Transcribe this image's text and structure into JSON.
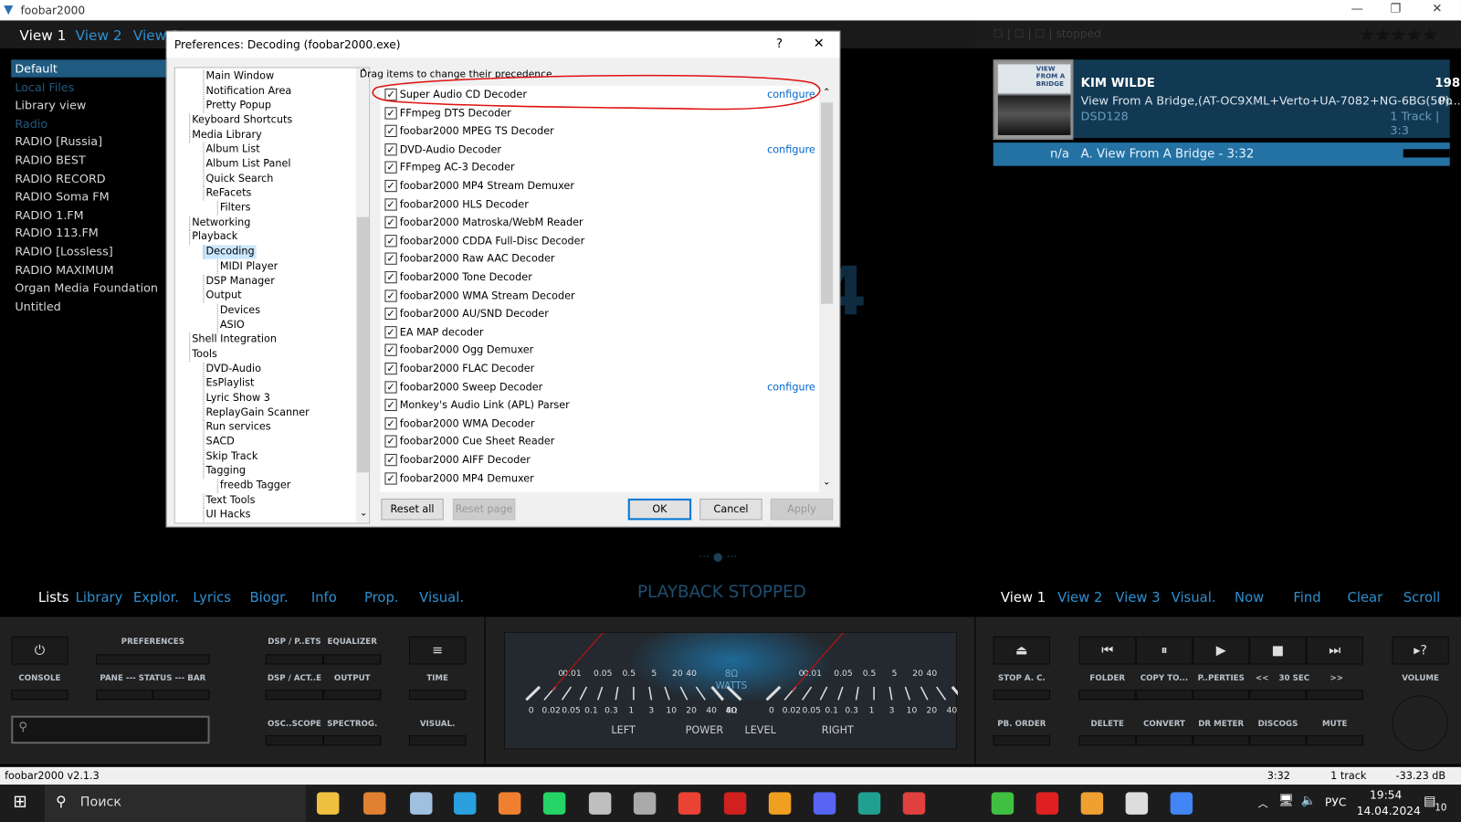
{
  "window": {
    "title": "foobar2000"
  },
  "top_tabs": [
    "View 1",
    "View 2",
    "View 3"
  ],
  "sidebar": [
    "Default",
    "Local Files",
    "Library view",
    "Radio",
    "RADIO [Russia]",
    "RADIO BEST",
    "RADIO RECORD",
    "RADIO Soma FM",
    "RADIO 1.FM",
    "RADIO 113.FM",
    "RADIO [Lossless]",
    "RADIO MAXIMUM",
    "Organ Media Foundation",
    "Untitled"
  ],
  "top_status": "☐ | ☐ | ☐ | stopped",
  "now_playing": {
    "artist": "KIM WILDE",
    "year": "198",
    "album": "View From A Bridge,(AT-OC9XML+Verto+UA-7082+NG-6BG(50)...",
    "extra": "Po",
    "format": "DSD128",
    "tracks": "1 Track | 3:3",
    "track_no": "n/a",
    "track": "A. View From A Bridge - 3:32",
    "cover_text": "VIEW FROM A BRIDGE"
  },
  "dialog": {
    "title": "Preferences: Decoding (foobar2000.exe)",
    "help": "?",
    "close": "✕",
    "hint": "Drag items to change their precedence.",
    "tree": [
      [
        "Main Window",
        2
      ],
      [
        "Notification Area",
        2
      ],
      [
        "Pretty Popup",
        2
      ],
      [
        "Keyboard Shortcuts",
        1
      ],
      [
        "Media Library",
        1,
        "e"
      ],
      [
        "Album List",
        2
      ],
      [
        "Album List Panel",
        2
      ],
      [
        "Quick Search",
        2
      ],
      [
        "ReFacets",
        2,
        "e"
      ],
      [
        "Filters",
        3
      ],
      [
        "Networking",
        1
      ],
      [
        "Playback",
        1,
        "e"
      ],
      [
        "Decoding",
        2,
        "e",
        "s"
      ],
      [
        "MIDI Player",
        3
      ],
      [
        "DSP Manager",
        2
      ],
      [
        "Output",
        2,
        "e"
      ],
      [
        "Devices",
        3
      ],
      [
        "ASIO",
        3
      ],
      [
        "Shell Integration",
        1
      ],
      [
        "Tools",
        1,
        "e"
      ],
      [
        "DVD-Audio",
        2
      ],
      [
        "EsPlaylist",
        2
      ],
      [
        "Lyric Show 3",
        2
      ],
      [
        "ReplayGain Scanner",
        2
      ],
      [
        "Run services",
        2
      ],
      [
        "SACD",
        2
      ],
      [
        "Skip Track",
        2
      ],
      [
        "Tagging",
        2,
        "e"
      ],
      [
        "freedb Tagger",
        3
      ],
      [
        "Text Tools",
        2
      ],
      [
        "UI Hacks",
        2,
        "e"
      ]
    ],
    "decoders": [
      {
        "name": "Super Audio CD Decoder",
        "configure": "configure"
      },
      {
        "name": "FFmpeg DTS Decoder"
      },
      {
        "name": "foobar2000 MPEG TS Decoder"
      },
      {
        "name": "DVD-Audio Decoder",
        "configure": "configure"
      },
      {
        "name": "FFmpeg AC-3 Decoder"
      },
      {
        "name": "foobar2000 MP4 Stream Demuxer"
      },
      {
        "name": "foobar2000 HLS Decoder"
      },
      {
        "name": "foobar2000 Matroska/WebM Reader"
      },
      {
        "name": "foobar2000 CDDA Full-Disc Decoder"
      },
      {
        "name": "foobar2000 Raw AAC Decoder"
      },
      {
        "name": "foobar2000 Tone Decoder"
      },
      {
        "name": "foobar2000 WMA Stream Decoder"
      },
      {
        "name": "foobar2000 AU/SND Decoder"
      },
      {
        "name": "EA MAP decoder"
      },
      {
        "name": "foobar2000 Ogg Demuxer"
      },
      {
        "name": "foobar2000 FLAC Decoder"
      },
      {
        "name": "foobar2000 Sweep Decoder",
        "configure": "configure"
      },
      {
        "name": "Monkey's Audio Link (APL) Parser"
      },
      {
        "name": "foobar2000 WMA Decoder"
      },
      {
        "name": "foobar2000 Cue Sheet Reader"
      },
      {
        "name": "foobar2000 AIFF Decoder"
      },
      {
        "name": "foobar2000 MP4 Demuxer"
      }
    ],
    "buttons": {
      "reset_all": "Reset all",
      "reset_page": "Reset page",
      "ok": "OK",
      "cancel": "Cancel",
      "apply": "Apply"
    }
  },
  "playback_stopped": "PLAYBACK STOPPED",
  "bottom_left_tabs": [
    "Lists",
    "Library",
    "Explor.",
    "Lyrics",
    "Biogr.",
    "Info",
    "Prop.",
    "Visual."
  ],
  "bottom_right_tabs": [
    "View 1",
    "View 2",
    "View 3",
    "Visual.",
    "Now",
    "Find",
    "Clear",
    "Scroll"
  ],
  "controls": {
    "preferences": "PREFERENCES",
    "console": "CONSOLE",
    "pane_status_bar": "PANE --- STATUS --- BAR",
    "dsp_presets": "DSP / P..ETS",
    "equalizer": "EQUALIZER",
    "dsp_active": "DSP / ACT..E",
    "output": "OUTPUT",
    "time": "TIME",
    "oscilloscope": "OSC..SCOPE",
    "spectrogram": "SPECTROG.",
    "visual": "VISUAL.",
    "stop_ac": "STOP A. C.",
    "folder": "FOLDER",
    "copy_to": "COPY TO...",
    "properties": "P..PERTIES",
    "back": "<<",
    "sec30": "30 SEC",
    "fwd": ">>",
    "volume": "VOLUME",
    "pb_order": "PB. ORDER",
    "delete": "DELETE",
    "convert": "CONVERT",
    "dr_meter": "DR METER",
    "discogs": "DISCOGS",
    "mute": "MUTE"
  },
  "vu": {
    "top_scale": [
      "0",
      "0.01",
      "0.05",
      "0.5",
      "5",
      "20",
      "40"
    ],
    "bottom_scale": [
      "0",
      "0.02",
      "0.05",
      "0.1",
      "0.3",
      "1",
      "3",
      "10",
      "20",
      "40",
      "80"
    ],
    "ohm8": "8Ω",
    "watts": "WATTS",
    "ohm4": "4Ω",
    "left": "LEFT",
    "power": "POWER",
    "level": "LEVEL",
    "right": "RIGHT"
  },
  "status": {
    "app": "foobar2000 v2.1.3",
    "time": "3:32",
    "tracks": "1 track",
    "volume": "-33.23 dB"
  },
  "taskbar": {
    "search": "Поиск",
    "lang": "РУС",
    "clock": "19:54",
    "date": "14.04.2024",
    "notifications": "10"
  }
}
